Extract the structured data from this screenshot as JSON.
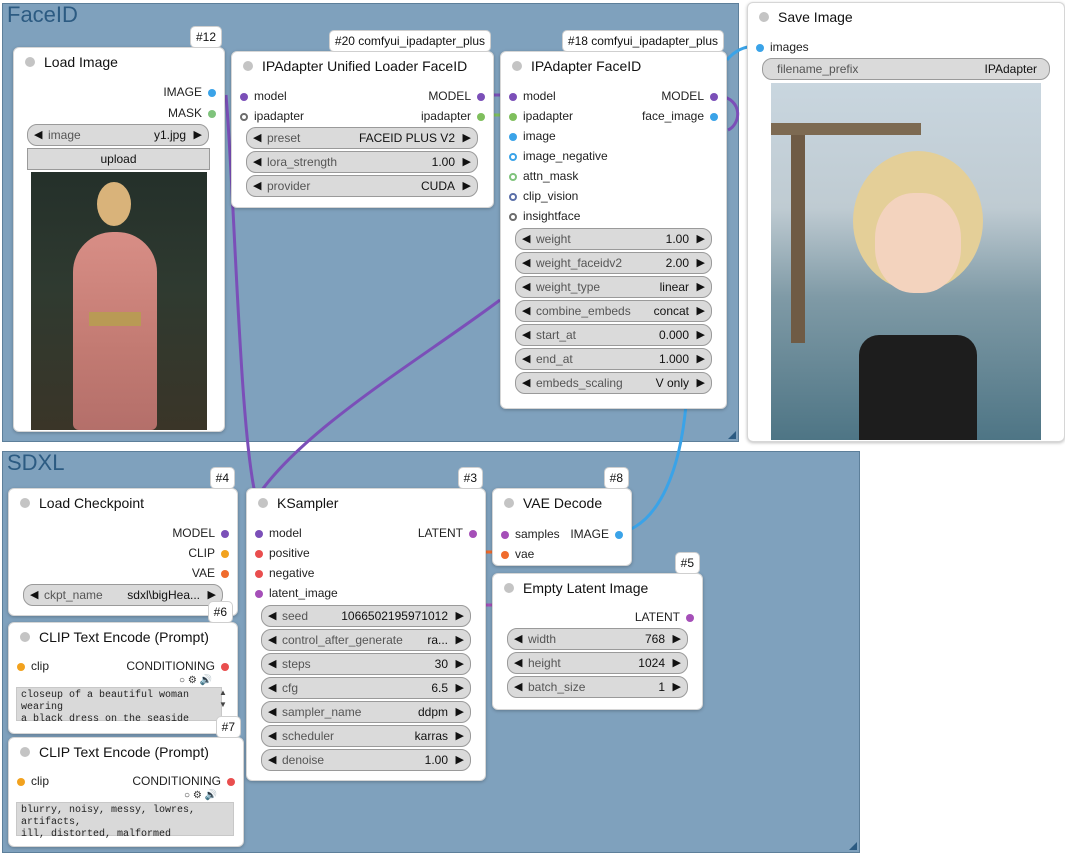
{
  "groups": {
    "faceid": "FaceID",
    "sdxl": "SDXL"
  },
  "colors": {
    "group_bg": "#7fa1bd",
    "model_link": "#7b4fb8",
    "image_link": "#3aa3e8"
  },
  "load_image": {
    "badge": "#12",
    "title": "Load Image",
    "out_image": "IMAGE",
    "out_mask": "MASK",
    "image_label": "image",
    "image_value": "y1.jpg",
    "upload_label": "upload"
  },
  "ip_loader": {
    "badge": "#20 comfyui_ipadapter_plus",
    "title": "IPAdapter Unified Loader FaceID",
    "in_model": "model",
    "in_ipadapter": "ipadapter",
    "out_model": "MODEL",
    "out_ipadapter": "ipadapter",
    "widgets": [
      {
        "label": "preset",
        "value": "FACEID PLUS V2"
      },
      {
        "label": "lora_strength",
        "value": "1.00"
      },
      {
        "label": "provider",
        "value": "CUDA"
      }
    ]
  },
  "ip_faceid": {
    "badge": "#18 comfyui_ipadapter_plus",
    "title": "IPAdapter FaceID",
    "out_model": "MODEL",
    "out_face_image": "face_image",
    "inputs": [
      "model",
      "ipadapter",
      "image",
      "image_negative",
      "attn_mask",
      "clip_vision",
      "insightface"
    ],
    "widgets": [
      {
        "label": "weight",
        "value": "1.00"
      },
      {
        "label": "weight_faceidv2",
        "value": "2.00"
      },
      {
        "label": "weight_type",
        "value": "linear"
      },
      {
        "label": "combine_embeds",
        "value": "concat"
      },
      {
        "label": "start_at",
        "value": "0.000"
      },
      {
        "label": "end_at",
        "value": "1.000"
      },
      {
        "label": "embeds_scaling",
        "value": "V only"
      }
    ]
  },
  "save_image": {
    "title": "Save Image",
    "in_images": "images",
    "prefix_label": "filename_prefix",
    "prefix_value": "IPAdapter"
  },
  "load_checkpoint": {
    "badge": "#4",
    "title": "Load Checkpoint",
    "out_model": "MODEL",
    "out_clip": "CLIP",
    "out_vae": "VAE",
    "ckpt_label": "ckpt_name",
    "ckpt_value": "sdxl\\bigHea..."
  },
  "clip_pos": {
    "badge": "#6",
    "title": "CLIP Text Encode (Prompt)",
    "in_clip": "clip",
    "out_cond": "CONDITIONING",
    "text": "closeup of a beautiful woman wearing\na black dress on the seaside"
  },
  "clip_neg": {
    "badge": "#7",
    "title": "CLIP Text Encode (Prompt)",
    "in_clip": "clip",
    "out_cond": "CONDITIONING",
    "text": "blurry, noisy, messy, lowres, artifacts,\nill, distorted, malformed"
  },
  "ksampler": {
    "badge": "#3",
    "title": "KSampler",
    "inputs": [
      "model",
      "positive",
      "negative",
      "latent_image"
    ],
    "out_latent": "LATENT",
    "widgets": [
      {
        "label": "seed",
        "value": "1066502195971012"
      },
      {
        "label": "control_after_generate",
        "value": "ra..."
      },
      {
        "label": "steps",
        "value": "30"
      },
      {
        "label": "cfg",
        "value": "6.5"
      },
      {
        "label": "sampler_name",
        "value": "ddpm"
      },
      {
        "label": "scheduler",
        "value": "karras"
      },
      {
        "label": "denoise",
        "value": "1.00"
      }
    ]
  },
  "vae_decode": {
    "badge": "#8",
    "title": "VAE Decode",
    "in_samples": "samples",
    "in_vae": "vae",
    "out_image": "IMAGE"
  },
  "empty_latent": {
    "badge": "#5",
    "title": "Empty Latent Image",
    "out_latent": "LATENT",
    "widgets": [
      {
        "label": "width",
        "value": "768"
      },
      {
        "label": "height",
        "value": "1024"
      },
      {
        "label": "batch_size",
        "value": "1"
      }
    ]
  }
}
